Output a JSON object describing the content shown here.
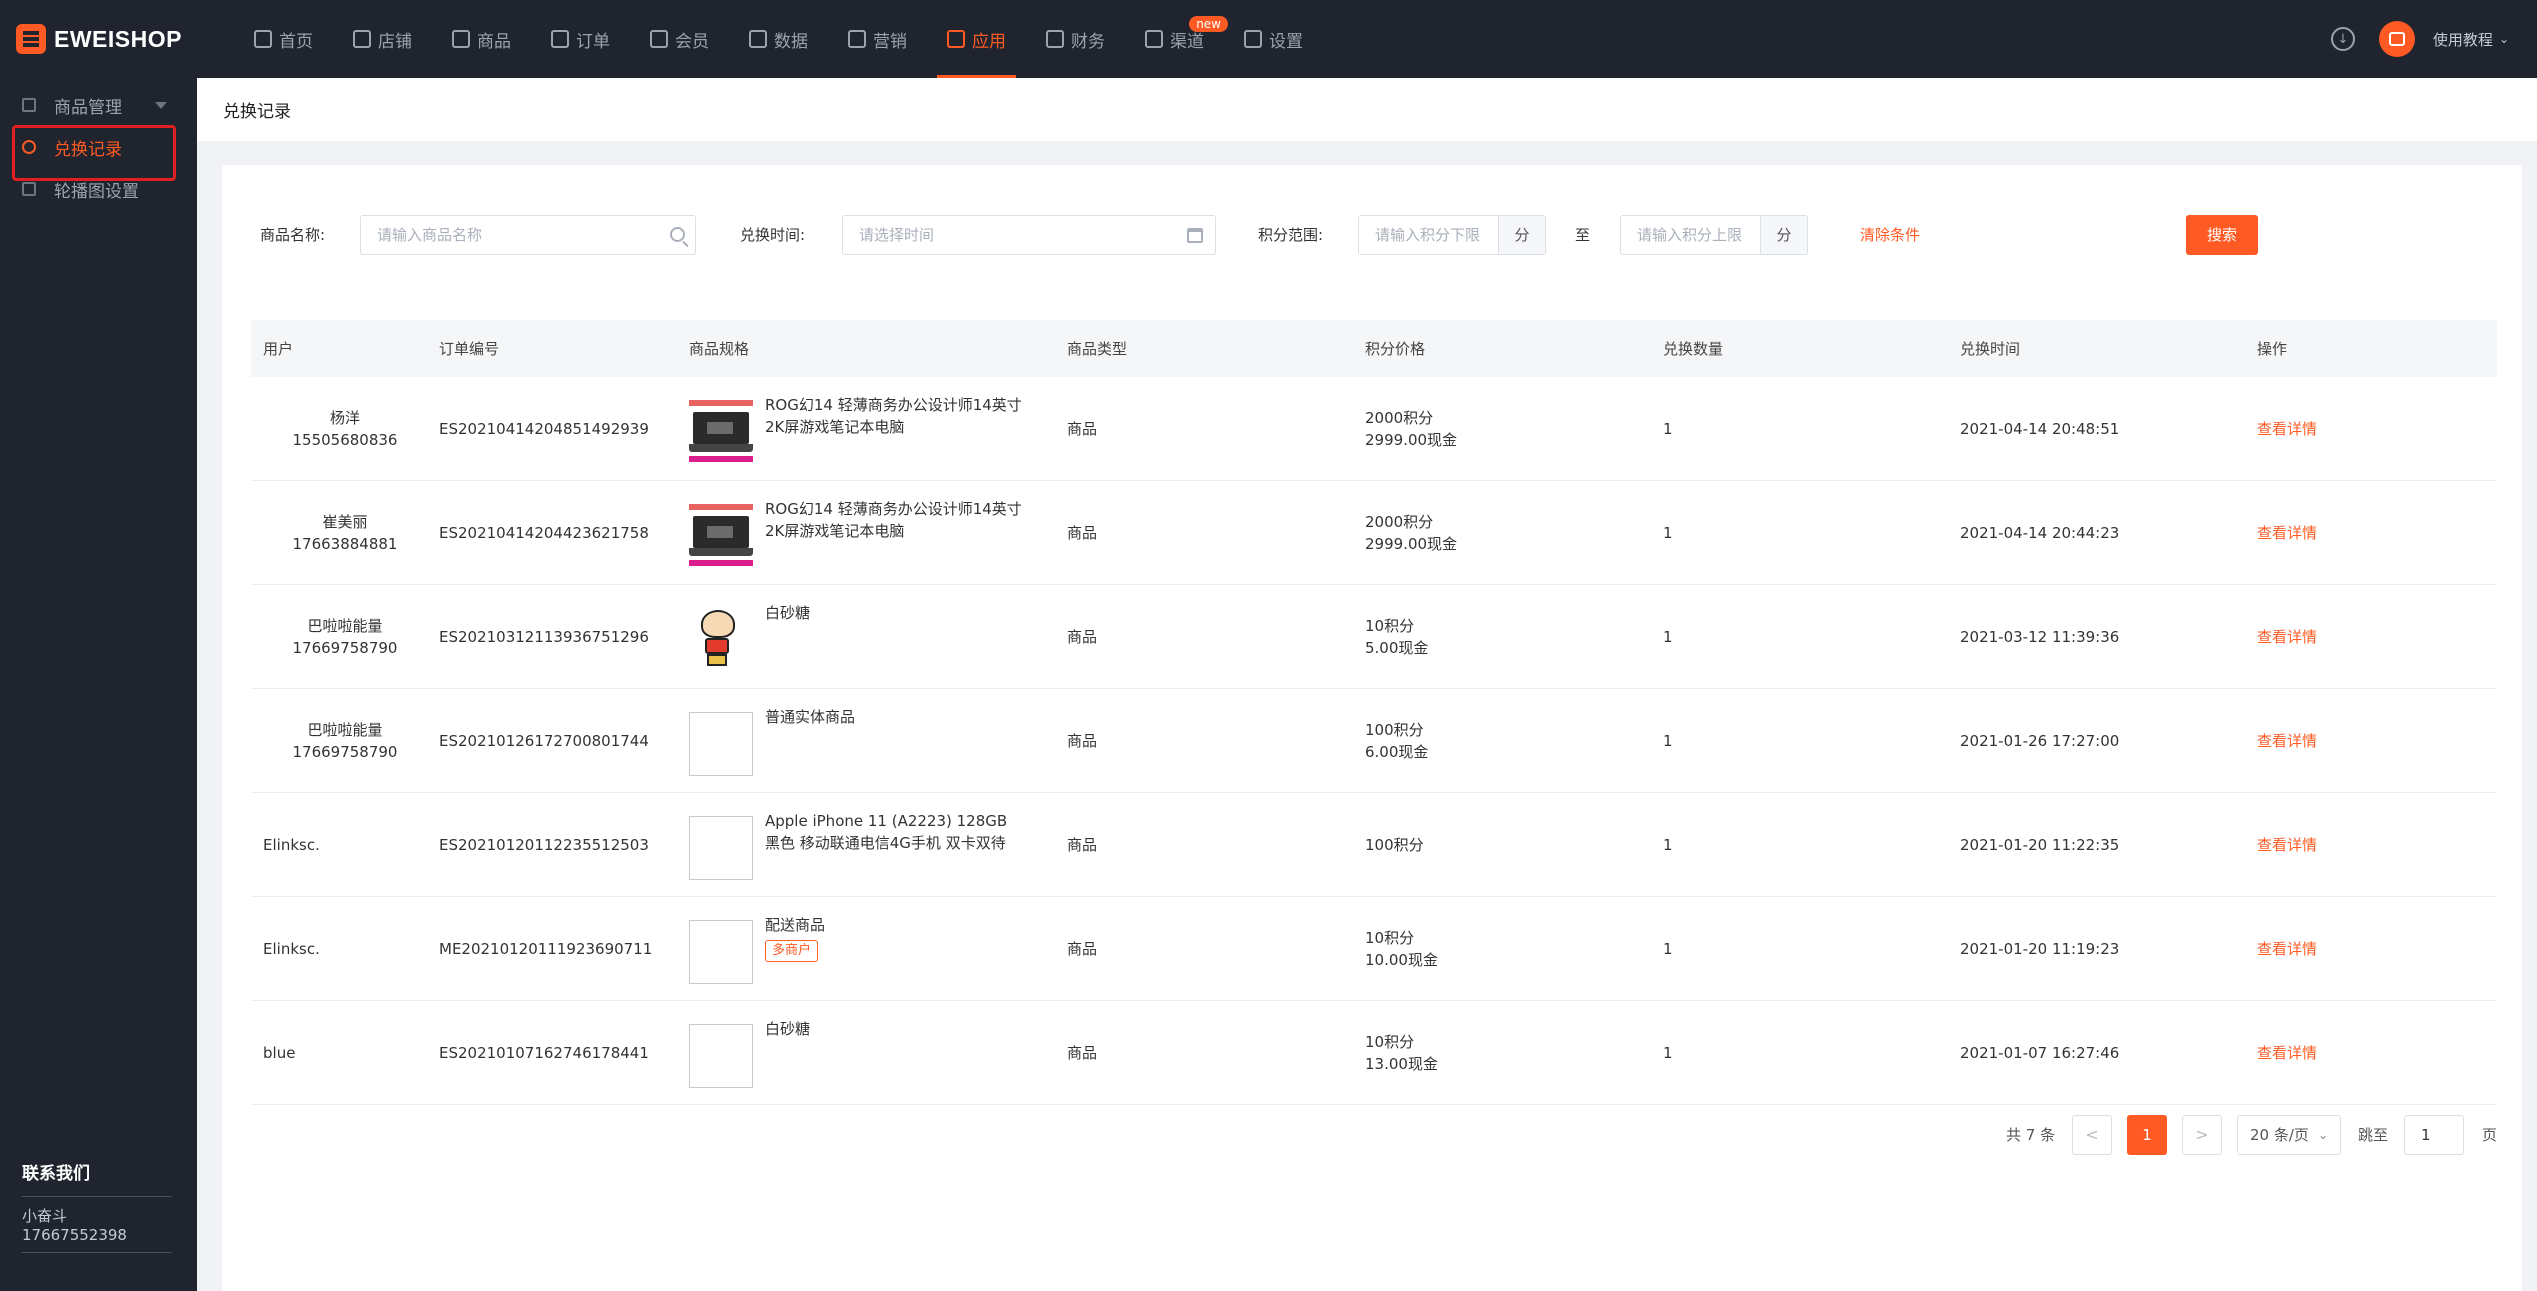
{
  "brand": {
    "name": "EWEISHOP",
    "accent": "#ff5a23"
  },
  "nav": {
    "items": [
      {
        "label": "首页",
        "icon": "home-icon"
      },
      {
        "label": "店铺",
        "icon": "store-icon"
      },
      {
        "label": "商品",
        "icon": "goods-icon"
      },
      {
        "label": "订单",
        "icon": "order-icon"
      },
      {
        "label": "会员",
        "icon": "member-icon"
      },
      {
        "label": "数据",
        "icon": "chart-icon"
      },
      {
        "label": "营销",
        "icon": "tag-icon"
      },
      {
        "label": "应用",
        "icon": "app-icon"
      },
      {
        "label": "财务",
        "icon": "finance-icon"
      },
      {
        "label": "渠道",
        "icon": "channel-icon",
        "badge": "new"
      },
      {
        "label": "设置",
        "icon": "gear-icon"
      }
    ],
    "active_index": 7,
    "tutorial": "使用教程"
  },
  "sidebar": {
    "items": [
      {
        "label": "商品管理",
        "icon": "goods-manage-icon"
      },
      {
        "label": "兑换记录",
        "icon": "record-icon"
      },
      {
        "label": "轮播图设置",
        "icon": "banner-icon"
      }
    ],
    "contact": {
      "title": "联系我们",
      "name": "小奋斗",
      "phone": "17667552398"
    }
  },
  "page": {
    "title": "兑换记录"
  },
  "filters": {
    "name_label": "商品名称:",
    "name_placeholder": "请输入商品名称",
    "time_label": "兑换时间:",
    "time_placeholder": "请选择时间",
    "points_label": "积分范围:",
    "points_min_placeholder": "请输入积分下限",
    "points_max_placeholder": "请输入积分上限",
    "unit": "分",
    "to": "至",
    "clear": "清除条件",
    "search": "搜索"
  },
  "table": {
    "headers": [
      "用户",
      "订单编号",
      "商品规格",
      "商品类型",
      "积分价格",
      "兑换数量",
      "兑换时间",
      "操作"
    ],
    "rows": [
      {
        "user": "杨洋",
        "phone": "15505680836",
        "order": "ES20210414204851492939",
        "image": "laptop",
        "spec": "ROG幻14 轻薄商务办公设计师14英寸2K屏游戏笔记本电脑",
        "tag": "",
        "type": "商品",
        "points": "2000积分",
        "cash": "2999.00现金",
        "qty": "1",
        "time": "2021-04-14 20:48:51",
        "action": "查看详情"
      },
      {
        "user": "崔美丽",
        "phone": "17663884881",
        "order": "ES20210414204423621758",
        "image": "laptop",
        "spec": "ROG幻14 轻薄商务办公设计师14英寸2K屏游戏笔记本电脑",
        "tag": "",
        "type": "商品",
        "points": "2000积分",
        "cash": "2999.00现金",
        "qty": "1",
        "time": "2021-04-14 20:44:23",
        "action": "查看详情"
      },
      {
        "user": "巴啦啦能量",
        "phone": "17669758790",
        "order": "ES20210312113936751296",
        "image": "cartoon",
        "spec": "白砂糖",
        "tag": "",
        "type": "商品",
        "points": "10积分",
        "cash": "5.00现金",
        "qty": "1",
        "time": "2021-03-12 11:39:36",
        "action": "查看详情"
      },
      {
        "user": "巴啦啦能量",
        "phone": "17669758790",
        "order": "ES20210126172700801744",
        "image": "placeholder",
        "spec": "普通实体商品",
        "tag": "",
        "type": "商品",
        "points": "100积分",
        "cash": "6.00现金",
        "qty": "1",
        "time": "2021-01-26 17:27:00",
        "action": "查看详情"
      },
      {
        "user": "Elinksc.",
        "phone": "",
        "order": "ES20210120112235512503",
        "image": "placeholder",
        "spec": "Apple iPhone 11 (A2223) 128GB 黑色 移动联通电信4G手机 双卡双待",
        "tag": "",
        "type": "商品",
        "points": "100积分",
        "cash": "",
        "qty": "1",
        "time": "2021-01-20 11:22:35",
        "action": "查看详情"
      },
      {
        "user": "Elinksc.",
        "phone": "",
        "order": "ME20210120111923690711",
        "image": "placeholder",
        "spec": "配送商品",
        "tag": "多商户",
        "type": "商品",
        "points": "10积分",
        "cash": "10.00现金",
        "qty": "1",
        "time": "2021-01-20 11:19:23",
        "action": "查看详情"
      },
      {
        "user": "blue",
        "phone": "",
        "order": "ES20210107162746178441",
        "image": "placeholder",
        "spec": "白砂糖",
        "tag": "",
        "type": "商品",
        "points": "10积分",
        "cash": "13.00现金",
        "qty": "1",
        "time": "2021-01-07 16:27:46",
        "action": "查看详情"
      }
    ]
  },
  "pagination": {
    "total": "共 7 条",
    "prev": "<",
    "current": "1",
    "next": ">",
    "page_size": "20 条/页",
    "jump_label": "跳至",
    "jump_value": "1",
    "page_suffix": "页"
  }
}
